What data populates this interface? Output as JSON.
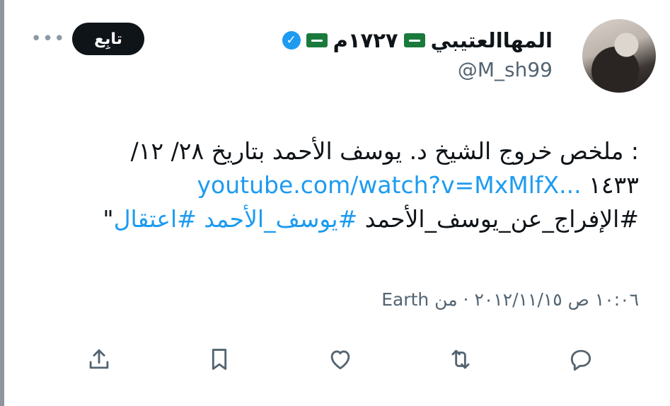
{
  "user": {
    "display_name": "المهاالعتيبي",
    "display_extra": "١٧٢٧م",
    "handle": "@M_sh99"
  },
  "header": {
    "follow_label": "تابِع",
    "more_label": "•••"
  },
  "tweet": {
    "line1": ": ملخص خروج الشيخ د. يوسف الأحمد بتاريخ ٢٨/ ١٢/",
    "line2_text": "١٤٣٣",
    "line2_link": "youtube.com/watch?v=MxMlfX...",
    "line3_plain": "#الإفراج_عن_يوسف_الأحمد",
    "line3_tag1": "#يوسف_الأحمد",
    "line3_tag2": "#اعتقال",
    "line3_quote": "\""
  },
  "meta": {
    "timestamp": "١٠:٠٦ ص ٢٠١٢/١١/١٥ · من Earth"
  },
  "colors": {
    "link": "#1d9bf0",
    "secondary_text": "#536471",
    "flag_green": "#1a7a3c",
    "verified_blue": "#1d9bf0"
  },
  "icons": [
    "saudi-flag-icon",
    "verified-badge-icon",
    "reply-icon",
    "retweet-icon",
    "like-icon",
    "bookmark-icon",
    "share-icon",
    "more-icon"
  ]
}
